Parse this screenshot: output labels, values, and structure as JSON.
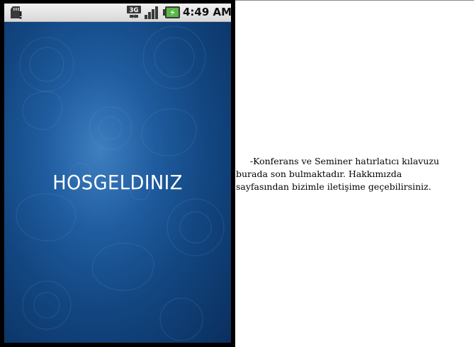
{
  "status_bar": {
    "time": "4:49 AM",
    "network": "3G",
    "battery_icon": "battery-charging-icon",
    "sd_icon": "sd-card-alert-icon",
    "signal_icon": "signal-bars-icon"
  },
  "screen": {
    "welcome_text": "HOSGELDINIZ",
    "background_color": "#1a4f8c"
  },
  "description": {
    "line1": "     -Konferans ve Seminer hatırlatıcı kılavuzu",
    "line2": "burada son bulmaktadır. Hakkımızda",
    "line3": "sayfasından bizimle iletişime geçebilirsiniz."
  }
}
